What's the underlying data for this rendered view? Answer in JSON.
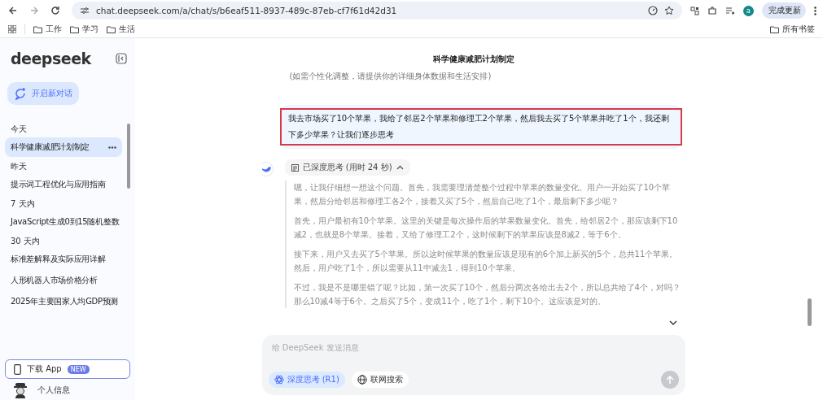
{
  "browser": {
    "url": "chat.deepseek.com/a/chat/s/b6eaf511-8937-489c-87eb-cf7f61d42d31",
    "profile_initial": "a",
    "update_button": "完成更新",
    "bookmarks": [
      "工作",
      "学习",
      "生活"
    ],
    "all_bookmarks": "所有书签"
  },
  "sidebar": {
    "logo": "deepseek",
    "new_chat": "开启新对话",
    "groups": [
      {
        "label": "今天",
        "items": [
          {
            "title": "科学健康减肥计划制定",
            "selected": true
          }
        ]
      },
      {
        "label": "昨天",
        "items": [
          {
            "title": "提示词工程优化与应用指南",
            "selected": false
          }
        ]
      },
      {
        "label": "7 天内",
        "items": [
          {
            "title": "JavaScript生成0到15随机整数",
            "selected": false
          }
        ]
      },
      {
        "label": "30 天内",
        "items": [
          {
            "title": "标准差解释及实际应用详解",
            "selected": false
          },
          {
            "title": "人形机器人市场价格分析",
            "selected": false
          },
          {
            "title": "2025年主要国家人均GDP预测",
            "selected": false
          }
        ]
      }
    ],
    "download_app": {
      "label": "下载 App",
      "badge": "NEW"
    },
    "profile": "个人信息"
  },
  "chat": {
    "title": "科学健康减肥计划制定",
    "previous_reply_tail": "(如需个性化调整，请提供你的详细身体数据和生活安排)",
    "user_message": {
      "text": "我去市场买了10个苹果，我给了邻居2个苹果和修理工2个苹果，然后我去买了5个苹果并吃了1个，我还剩下多少苹果？让我们逐步思考",
      "highlighted": true
    },
    "thinking": {
      "label": "已深度思考 (用时 24 秒)",
      "expanded": true,
      "paragraphs": [
        "嗯，让我仔细想一想这个问题。首先，我需要理清楚整个过程中苹果的数量变化。用户一开始买了10个苹果，然后分给邻居和修理工各2个，接着又买了5个，然后自己吃了1个，最后剩下多少呢？",
        "首先，用户最初有10个苹果。这里的关键是每次操作后的苹果数量变化。首先，给邻居2个，那应该剩下10减2，也就是8个苹果。接着，又给了修理工2个，这时候剩下的苹果应该是8减2，等于6个。",
        "接下来，用户又去买了5个苹果。所以这时候苹果的数量应该是现有的6个加上新买的5个，总共11个苹果。然后，用户吃了1个，所以需要从11中减去1，得到10个苹果。",
        "不过，我是不是哪里错了呢？比如，第一次买了10个，然后分两次各给出去2个，所以总共给了4个，对吗？那么10减4等于6个。之后买了5个，变成11个，吃了1个，剩下10个。这应该是对的。"
      ]
    },
    "composer": {
      "placeholder": "给 DeepSeek 发送消息",
      "toggles": [
        {
          "label": "深度思考 (R1)",
          "selected": true
        },
        {
          "label": "联网搜索",
          "selected": false
        }
      ]
    }
  }
}
